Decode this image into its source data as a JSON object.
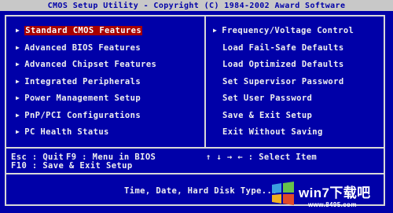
{
  "title": "CMOS Setup Utility - Copyright (C) 1984-2002 Award Software",
  "left_menu": [
    {
      "label": "Standard CMOS Features",
      "selected": true
    },
    {
      "label": "Advanced BIOS Features",
      "selected": false
    },
    {
      "label": "Advanced Chipset Features",
      "selected": false
    },
    {
      "label": "Integrated Peripherals",
      "selected": false
    },
    {
      "label": "Power Management Setup",
      "selected": false
    },
    {
      "label": "PnP/PCI Configurations",
      "selected": false
    },
    {
      "label": "PC Health Status",
      "selected": false
    }
  ],
  "right_menu": [
    {
      "label": "Frequency/Voltage Control",
      "has_arrow": true
    },
    {
      "label": "Load Fail-Safe Defaults",
      "has_arrow": false
    },
    {
      "label": "Load Optimized Defaults",
      "has_arrow": false
    },
    {
      "label": "Set Supervisor Password",
      "has_arrow": false
    },
    {
      "label": "Set User Password",
      "has_arrow": false
    },
    {
      "label": "Save & Exit Setup",
      "has_arrow": false
    },
    {
      "label": "Exit Without Saving",
      "has_arrow": false
    }
  ],
  "help": {
    "esc": "Esc : Quit",
    "f9": "F9 : Menu in BIOS",
    "arrows": "↑ ↓ → ←   : Select Item",
    "f10": "F10 : Save & Exit Setup"
  },
  "status": "Time, Date, Hard Disk Type...",
  "watermark": {
    "site_name": "win7下载吧",
    "site_url": "www.8495.com"
  },
  "colors": {
    "background": "#0000a8",
    "highlight": "#a80000",
    "text": "#f0f0f0",
    "title_bar": "#c8c8c8"
  }
}
